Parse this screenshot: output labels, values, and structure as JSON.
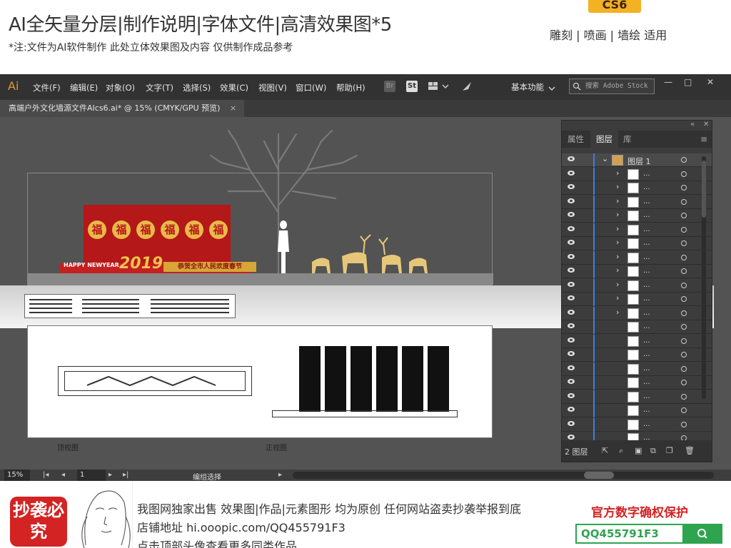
{
  "header": {
    "title": "AI全矢量分层|制作说明|字体文件|高清效果图*5",
    "note": "*注:文件为AI软件制作 此处立体效果图及内容 仅供制作成品参考",
    "cs_badge": "CS6",
    "usage": "雕刻 | 喷画 | 墙绘 适用"
  },
  "app": {
    "logo": "Ai",
    "menu": [
      "文件(F)",
      "编辑(E)",
      "对象(O)",
      "文字(T)",
      "选择(S)",
      "效果(C)",
      "视图(V)",
      "窗口(W)",
      "帮助(H)"
    ],
    "bridge_label": "Br",
    "stock_label": "St",
    "workspace": "基本功能",
    "search_placeholder": "搜索 Adobe Stock",
    "doc_tab": "高端户外文化墙源文件AIcs6.ai* @ 15% (CMYK/GPU 预览)",
    "doc_tab_close": "×",
    "status": {
      "zoom": "15%",
      "page": "1",
      "tool": "编组选择"
    }
  },
  "artwork": {
    "banner_year": "2019",
    "banner_slogan": "恭贺全市人民欢度春节",
    "banner_happy": "HAPPY NEWYEAR",
    "fu_char": "福",
    "label_top_view": "顶视图",
    "label_front_view": "正视图"
  },
  "panel": {
    "tabs": [
      "属性",
      "图层",
      "库"
    ],
    "layer_name": "图层 1",
    "sublayer_label": "...",
    "layer_count": "2 图层",
    "rows": 21
  },
  "footer": {
    "stamp_text": "抄袭必究",
    "line1": "我图网独家出售 效果图|作品|元素图形 均为原创 任何网站盗卖抄袭举报到底",
    "line2": "店铺地址 hi.ooopic.com/QQ455791F3",
    "line3": "点击顶部头像查看更多同类作品",
    "protect": "官方数字确权保护",
    "qq_code": "QQ455791F3"
  },
  "colors": {
    "accent_red": "#d32323",
    "accent_green": "#2ea44f",
    "ai_orange": "#e09a3c",
    "cs_gold": "#f3b124",
    "layer_blue": "#3b7ee8"
  }
}
